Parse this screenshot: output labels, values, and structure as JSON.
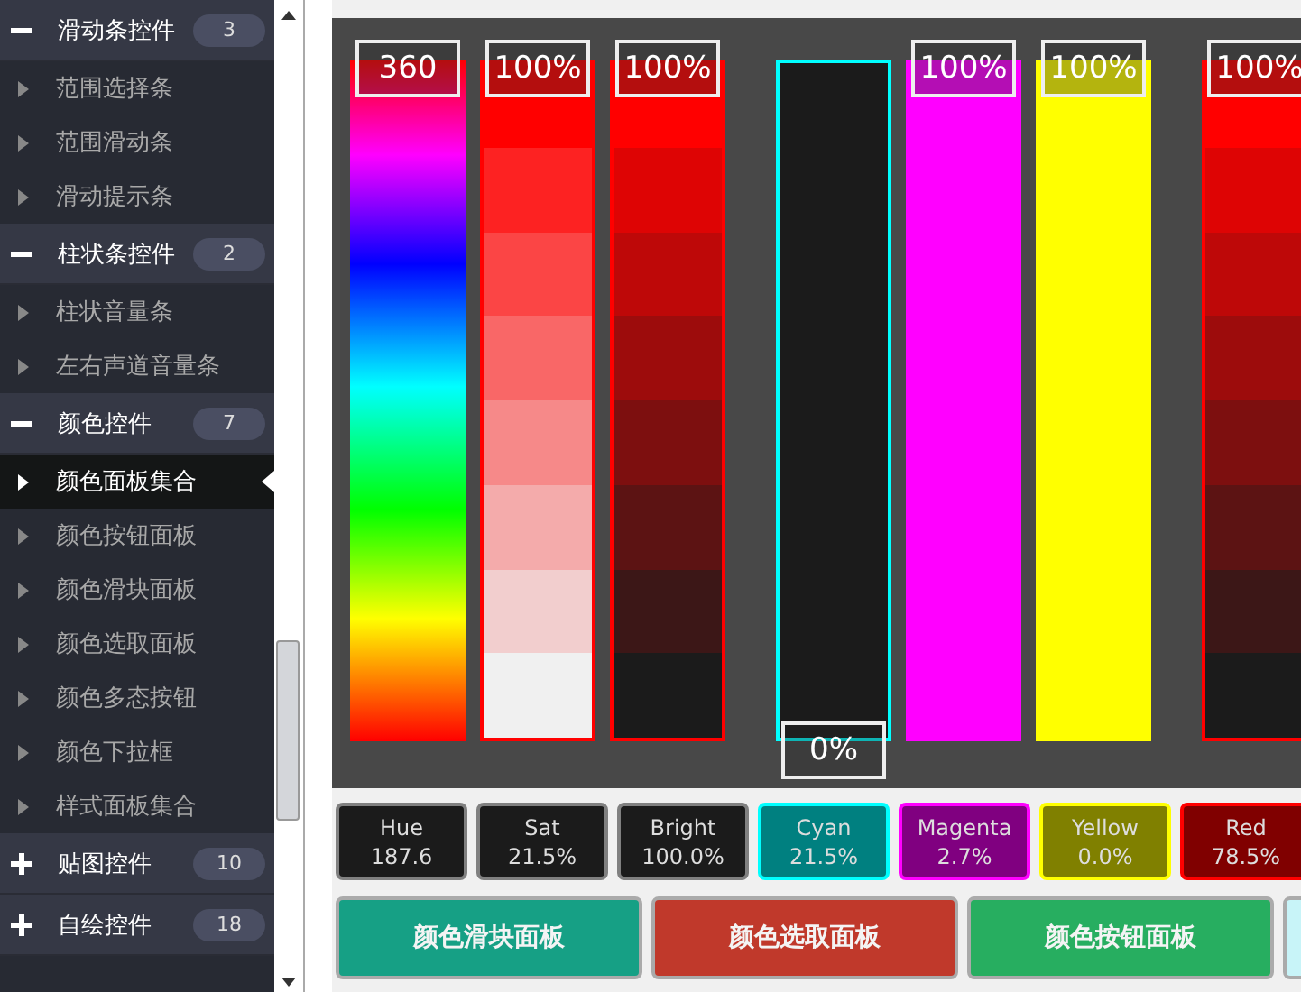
{
  "sidebar": {
    "groups": [
      {
        "label": "滑动条控件",
        "count": "3",
        "expanded": true,
        "items": [
          {
            "label": "范围选择条",
            "selected": false
          },
          {
            "label": "范围滑动条",
            "selected": false
          },
          {
            "label": "滑动提示条",
            "selected": false
          }
        ]
      },
      {
        "label": "柱状条控件",
        "count": "2",
        "expanded": true,
        "items": [
          {
            "label": "柱状音量条",
            "selected": false
          },
          {
            "label": "左右声道音量条",
            "selected": false
          }
        ]
      },
      {
        "label": "颜色控件",
        "count": "7",
        "expanded": true,
        "items": [
          {
            "label": "颜色面板集合",
            "selected": true
          },
          {
            "label": "颜色按钮面板",
            "selected": false
          },
          {
            "label": "颜色滑块面板",
            "selected": false
          },
          {
            "label": "颜色选取面板",
            "selected": false
          },
          {
            "label": "颜色多态按钮",
            "selected": false
          },
          {
            "label": "颜色下拉框",
            "selected": false
          },
          {
            "label": "样式面板集合",
            "selected": false
          }
        ]
      },
      {
        "label": "贴图控件",
        "count": "10",
        "expanded": false
      },
      {
        "label": "自绘控件",
        "count": "18",
        "expanded": false
      }
    ]
  },
  "slider_groups": [
    [
      {
        "kind": "hue",
        "label": "360",
        "level": 1,
        "color": "#ff0000"
      },
      {
        "kind": "fade-white",
        "label": "100%",
        "level": 1,
        "color": "#ff0000"
      },
      {
        "kind": "fade-black",
        "label": "100%",
        "level": 1,
        "color": "#ff0000"
      }
    ],
    [
      {
        "kind": "outline",
        "label": "0%",
        "level": 0,
        "color": "#00ffff"
      },
      {
        "kind": "solid",
        "label": "100%",
        "level": 1,
        "color": "#ff00ff"
      },
      {
        "kind": "solid",
        "label": "100%",
        "level": 1,
        "color": "#ffff00"
      }
    ],
    [
      {
        "kind": "fade-black",
        "label": "100%",
        "level": 1,
        "color": "#ff0000"
      }
    ]
  ],
  "readouts": [
    {
      "kind": "neutral",
      "name": "Hue",
      "value": "187.6",
      "color": "#808080"
    },
    {
      "kind": "neutral",
      "name": "Sat",
      "value": "21.5%",
      "color": "#808080"
    },
    {
      "kind": "neutral",
      "name": "Bright",
      "value": "100.0%",
      "color": "#808080"
    },
    {
      "kind": "tinted",
      "name": "Cyan",
      "value": "21.5%",
      "color": "#00ffff"
    },
    {
      "kind": "tinted",
      "name": "Magenta",
      "value": "2.7%",
      "color": "#ff00ff"
    },
    {
      "kind": "tinted",
      "name": "Yellow",
      "value": "0.0%",
      "color": "#ffff00"
    },
    {
      "kind": "tinted",
      "name": "Red",
      "value": "78.5%",
      "color": "#ff0000"
    }
  ],
  "buttons": [
    {
      "label": "颜色滑块面板",
      "color": "#16a085"
    },
    {
      "label": "颜色选取面板",
      "color": "#c0392b"
    },
    {
      "label": "颜色按钮面板",
      "color": "#27ae60"
    },
    {
      "color": "#c8f4f8"
    }
  ]
}
